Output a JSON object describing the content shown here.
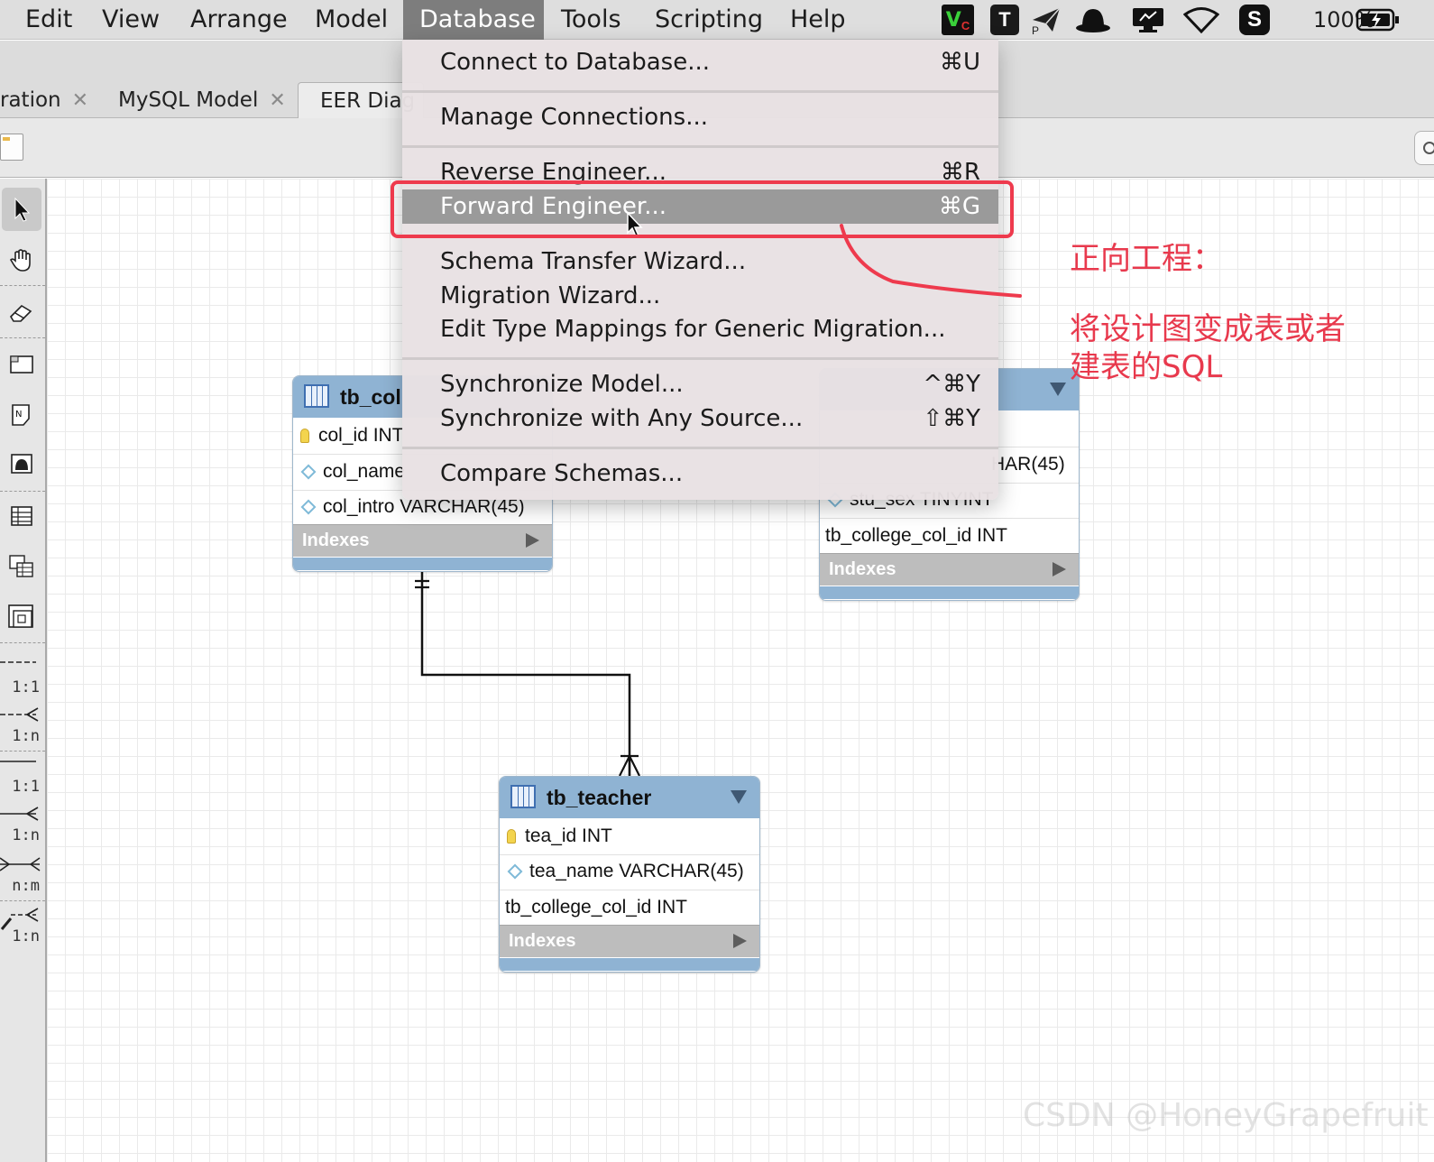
{
  "menubar": {
    "items": [
      "Edit",
      "View",
      "Arrange",
      "Model",
      "Database",
      "Tools",
      "Scripting",
      "Help"
    ],
    "active": "Database",
    "status_icons": [
      "vc-app-icon",
      "typora-icon",
      "paper-plane-icon",
      "hat-icon",
      "display-icon",
      "wifi-icon",
      "s-app-icon"
    ],
    "vc_label": "V",
    "vc_sub": "C",
    "typora_label": "T",
    "s_label": "S",
    "paper_sub": "P",
    "battery": "100%"
  },
  "tabs": [
    {
      "label": "ration",
      "close": "✕"
    },
    {
      "label": "MySQL Model",
      "close": "✕"
    },
    {
      "label": "EER Diag"
    }
  ],
  "palette": {
    "rel_labels": [
      "1:1",
      "1:n",
      "1:1",
      "1:n",
      "n:m",
      "1:n"
    ]
  },
  "database_menu": {
    "items": [
      {
        "label": "Connect to Database...",
        "shortcut": "⌘U"
      },
      {
        "label": "Manage Connections...",
        "shortcut": ""
      },
      {
        "label": "Reverse Engineer...",
        "shortcut": "⌘R"
      },
      {
        "label": "Forward Engineer...",
        "shortcut": "⌘G",
        "highlighted": true
      },
      {
        "label": "Schema Transfer Wizard...",
        "shortcut": ""
      },
      {
        "label": "Migration Wizard...",
        "shortcut": ""
      },
      {
        "label": "Edit Type Mappings for Generic Migration...",
        "shortcut": ""
      },
      {
        "label": "Synchronize Model...",
        "shortcut": "^⌘Y"
      },
      {
        "label": "Synchronize with Any Source...",
        "shortcut": "⇧⌘Y"
      },
      {
        "label": "Compare Schemas...",
        "shortcut": ""
      }
    ]
  },
  "entities": {
    "college": {
      "title": "tb_col",
      "columns": [
        "col_id INT",
        "col_name",
        "col_intro VARCHAR(45)"
      ],
      "indexes_label": "Indexes"
    },
    "student": {
      "title": "",
      "columns": [
        "HAR(45)",
        "stu_sex TINYINT",
        "tb_college_col_id INT"
      ],
      "indexes_label": "Indexes"
    },
    "teacher": {
      "title": "tb_teacher",
      "columns": [
        "tea_id INT",
        "tea_name VARCHAR(45)",
        "tb_college_col_id INT"
      ],
      "indexes_label": "Indexes"
    }
  },
  "annotation": {
    "title": "正向工程：",
    "line1": "将设计图变成表或者",
    "line2": "建表的SQL",
    "color": "#e8394d"
  },
  "watermark": "CSDN @HoneyGrapefruit"
}
